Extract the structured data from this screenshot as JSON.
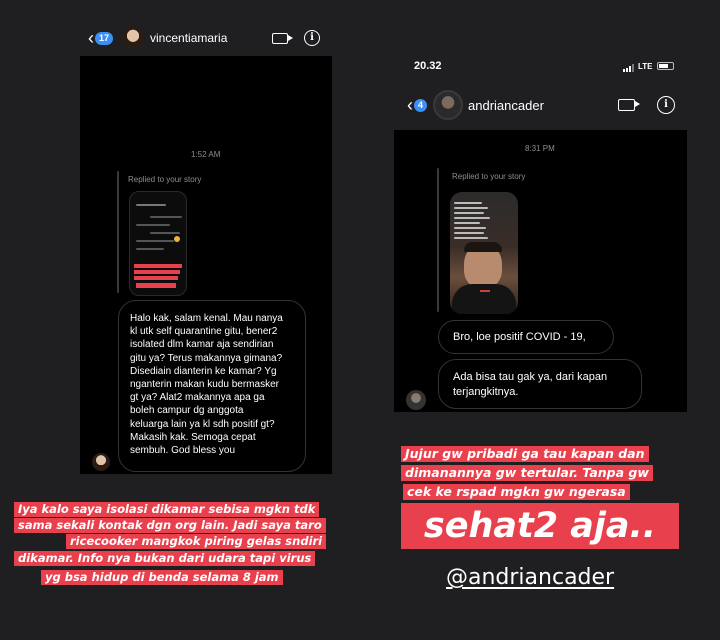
{
  "left_chat": {
    "header": {
      "badge_count": "17",
      "username": "vincentiamaria"
    },
    "timestamp": "1:52 AM",
    "reply_label": "Replied to your story",
    "message": "Halo kak, salam kenal. Mau nanya kl utk self quarantine gitu, bener2 isolated dlm kamar aja sendirian gitu ya? Terus makannya gimana? Disediain dianterin ke kamar? Yg nganterin makan kudu bermasker gt ya? Alat2 makannya apa ga boleh campur dg anggota keluarga lain ya kl sdh positif gt? Makasih kak. Semoga cepat sembuh. God bless you",
    "message_lines": [
      "Halo kak, salam kenal. Mau nanya",
      "kl utk self quarantine gitu, bener2",
      "isolated dlm kamar aja sendirian",
      "gitu ya? Terus makannya gimana?",
      "Disediain dianterin ke kamar? Yg",
      "nganterin makan kudu bermasker",
      "gt ya? Alat2 makannya apa ga",
      "boleh campur dg anggota",
      "keluarga lain ya kl sdh positif gt?",
      "Makasih kak. Semoga cepat",
      "sembuh. God bless you"
    ]
  },
  "right_chat": {
    "status_bar": {
      "time": "20.32",
      "network": "LTE"
    },
    "header": {
      "badge_count": "4",
      "username": "andriancader"
    },
    "timestamp": "8:31 PM",
    "reply_label": "Replied to your story",
    "message_1": "Bro, loe positif COVID - 19,",
    "message_2_lines": [
      "Ada bisa tau gak ya, dari kapan",
      "terjangkitnya."
    ]
  },
  "captions": {
    "left": [
      "Iya kalo saya isolasi dikamar sebisa mgkn tdk",
      "sama sekali kontak dgn org lain. Jadi saya taro",
      "ricecooker mangkok piring gelas sndiri",
      "dikamar. Info nya bukan dari udara tapi virus",
      "yg bsa hidup di benda selama 8 jam"
    ],
    "right": [
      "Jujur gw pribadi ga tau kapan dan",
      "dimanannya gw tertular. Tanpa gw",
      "cek ke rspad mgkn gw ngerasa"
    ],
    "right_big": "sehat2 aja..",
    "handle": "@andriancader"
  },
  "colors": {
    "caption_red": "#e8414d",
    "badge_blue": "#3b8ff6",
    "background": "#1f1f21"
  }
}
